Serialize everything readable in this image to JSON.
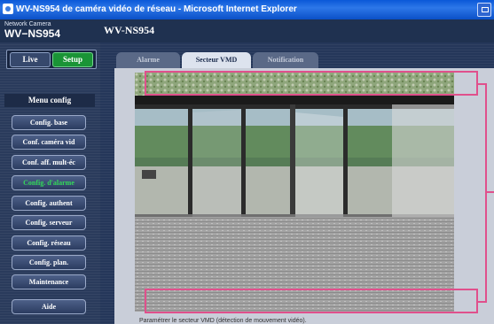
{
  "window": {
    "title": "WV-NS954 de caméra vidéo de réseau - Microsoft Internet Explorer"
  },
  "header": {
    "camera_label": "Network Camera",
    "camera_model": "WV−NS954",
    "page_model": "WV-NS954"
  },
  "mode": {
    "live_label": "Live",
    "setup_label": "Setup",
    "active": "Setup"
  },
  "sidebar": {
    "title": "Menu config",
    "items": [
      {
        "label": "Config. base"
      },
      {
        "label": "Conf. caméra vid"
      },
      {
        "label": "Conf. aff. mult-éc"
      },
      {
        "label": "Config. d'alarme",
        "active": true
      },
      {
        "label": "Config. authent"
      },
      {
        "label": "Config. serveur"
      },
      {
        "label": "Config. réseau"
      },
      {
        "label": "Config. plan."
      },
      {
        "label": "Maintenance"
      },
      {
        "label": "Aide"
      }
    ]
  },
  "tabs": [
    {
      "label": "Alarme",
      "active": false
    },
    {
      "label": "Secteur VMD",
      "active": true
    },
    {
      "label": "Notification",
      "active": false
    }
  ],
  "camera_view": {
    "description_text": "Paramétrer le secteur VMD (détection de mouvement vidéo)."
  },
  "colors": {
    "accent_pink": "#e0508c",
    "setup_green": "#1a9436",
    "active_menu_text": "#34d95a"
  }
}
